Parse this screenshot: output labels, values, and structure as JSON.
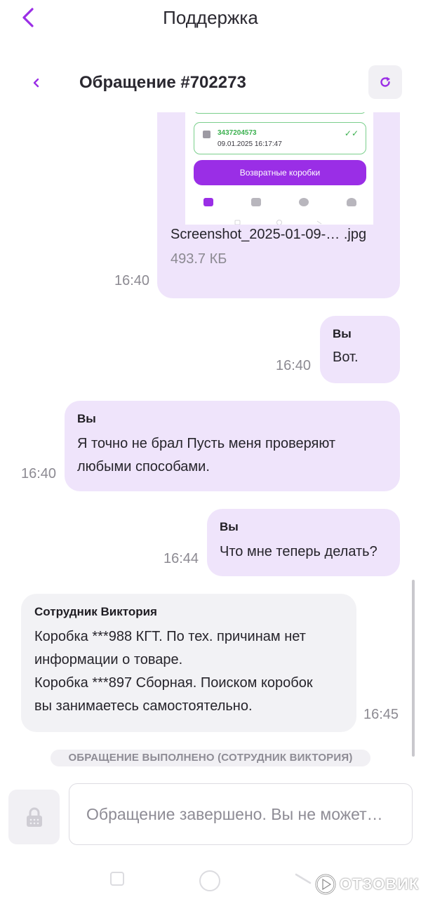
{
  "header": {
    "title": "Поддержка"
  },
  "ticket": {
    "title": "Обращение #702273"
  },
  "attachment": {
    "shot_code": "3437204573",
    "shot_date": "09.01.2025 16:17:47",
    "shot_button": "Возвратные коробки",
    "file_name": "Screenshot_2025-01-09-… .jpg",
    "file_size": "493.7 КБ",
    "time": "16:40"
  },
  "messages": [
    {
      "sender": "Вы",
      "lines": [
        "Вот."
      ],
      "time": "16:40"
    },
    {
      "sender": "Вы",
      "lines": [
        "Я точно не брал Пусть меня проверяют",
        "любыми способами."
      ],
      "time": "16:40"
    },
    {
      "sender": "Вы",
      "lines": [
        "Что мне теперь делать?"
      ],
      "time": "16:44"
    },
    {
      "sender": "Сотрудник Виктория",
      "lines": [
        "Коробка ***988 КГТ. По тех. причинам нет",
        "информации о товаре.",
        "Коробка ***897 Сборная. Поиском коробок",
        "вы занимаетесь самостоятельно."
      ],
      "time": "16:45"
    }
  ],
  "status": "ОБРАЩЕНИЕ ВЫПОЛНЕНО (СОТРУДНИК ВИКТОРИЯ)",
  "input": {
    "placeholder": "Обращение завершено. Вы не может…"
  },
  "watermark": "ОТЗОВИК",
  "colors": {
    "accent": "#9a2ee6",
    "own_bubble": "#efe4fb",
    "staff_bubble": "#f2f2f5"
  }
}
